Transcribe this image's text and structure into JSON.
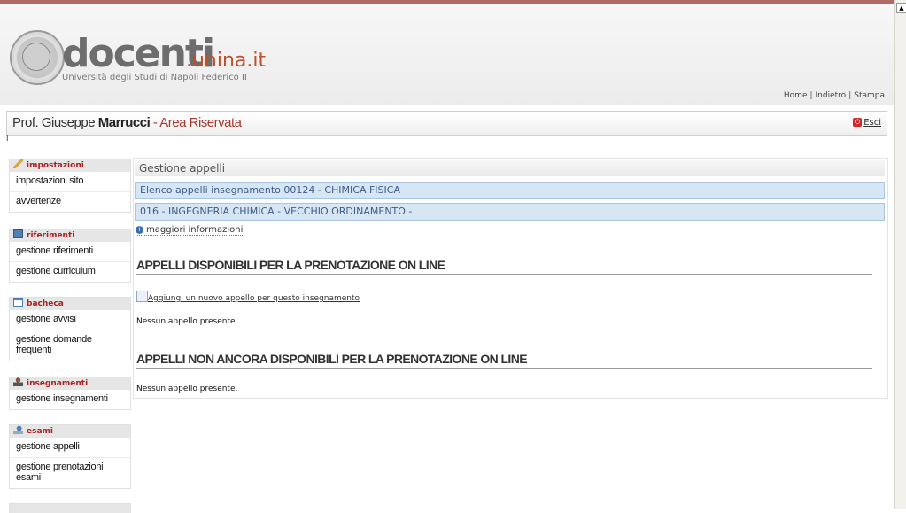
{
  "header": {
    "brand_main": "docenti",
    "brand_suffix": ".unina.it",
    "brand_subtitle": "Università degli Studi di Napoli Federico II",
    "toplinks": {
      "home": "Home",
      "back": "Indietro",
      "print": "Stampa",
      "separator": "|"
    }
  },
  "titlebar": {
    "prefix": "Prof. Giuseppe ",
    "surname": "Marrucci",
    "area": " - Area Riservata",
    "logout": "Esci",
    "stray_char": "i"
  },
  "sidebar": {
    "sections": [
      {
        "title": "impostazioni",
        "icon": "wrench-icon",
        "items": [
          "impostazioni sito",
          "avvertenze"
        ]
      },
      {
        "title": "riferimenti",
        "icon": "contact-card-icon",
        "items": [
          "gestione riferimenti",
          "gestione curriculum"
        ]
      },
      {
        "title": "bacheca",
        "icon": "window-icon",
        "items": [
          "gestione avvisi",
          "gestione domande frequenti"
        ]
      },
      {
        "title": "insegnamenti",
        "icon": "teacher-icon",
        "items": [
          "gestione insegnamenti"
        ]
      },
      {
        "title": "esami",
        "icon": "exam-icon",
        "items": [
          "gestione appelli",
          "gestione prenotazioni esami"
        ]
      }
    ]
  },
  "main": {
    "section_title": "Gestione appelli",
    "course_bar": "Elenco appelli insegnamento 00124 - CHIMICA FISICA",
    "degree_bar": "016 - INGEGNERIA CHIMICA - VECCHIO ORDINAMENTO -",
    "more_info": "maggiori informazioni",
    "available_title": "APPELLI DISPONIBILI PER LA PRENOTAZIONE ON LINE",
    "add_link": "Aggiungi un nuovo appello per questo insegnamento",
    "available_empty": "Nessun appello presente.",
    "unavailable_title": "APPELLI NON ANCORA DISPONIBILI PER LA PRENOTAZIONE ON LINE",
    "unavailable_empty": "Nessun appello presente."
  },
  "colors": {
    "accent_red": "#a33a2e",
    "brand_orange": "#c0502a",
    "bar_blue": "#d6e6f5"
  }
}
